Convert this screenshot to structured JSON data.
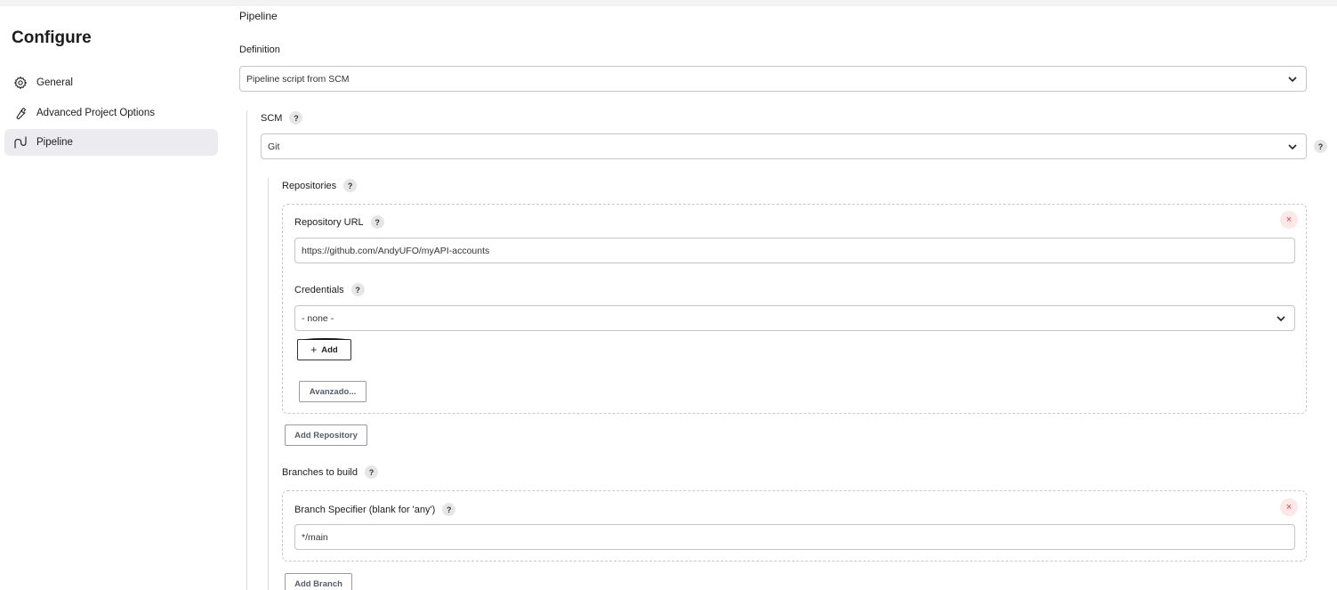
{
  "sidebar": {
    "title": "Configure",
    "items": [
      {
        "label": "General",
        "icon": "gear-icon"
      },
      {
        "label": "Advanced Project Options",
        "icon": "wrench-icon"
      },
      {
        "label": "Pipeline",
        "icon": "pipeline-icon",
        "active": true
      }
    ]
  },
  "main": {
    "section_title": "Pipeline",
    "definition": {
      "label": "Definition",
      "value": "Pipeline script from SCM"
    },
    "scm": {
      "label": "SCM",
      "help": "?",
      "value": "Git"
    },
    "repositories": {
      "label": "Repositories",
      "help": "?",
      "repository_url": {
        "label": "Repository URL",
        "help": "?",
        "value": "https://github.com/AndyUFO/myAPI-accounts"
      },
      "credentials": {
        "label": "Credentials",
        "help": "?",
        "value": "- none -"
      },
      "add_label": "Add",
      "advanced_label": "Avanzado...",
      "remove_label": "×",
      "add_repository_label": "Add Repository"
    },
    "branches": {
      "label": "Branches to build",
      "help": "?",
      "branch_specifier": {
        "label": "Branch Specifier (blank for 'any')",
        "help": "?",
        "value": "*/main"
      },
      "remove_label": "×",
      "add_branch_label": "Add Branch"
    }
  },
  "colors": {
    "active_item_bg": "#ececf0",
    "remove_red": "#e0404a",
    "border": "#c4c4c9"
  }
}
